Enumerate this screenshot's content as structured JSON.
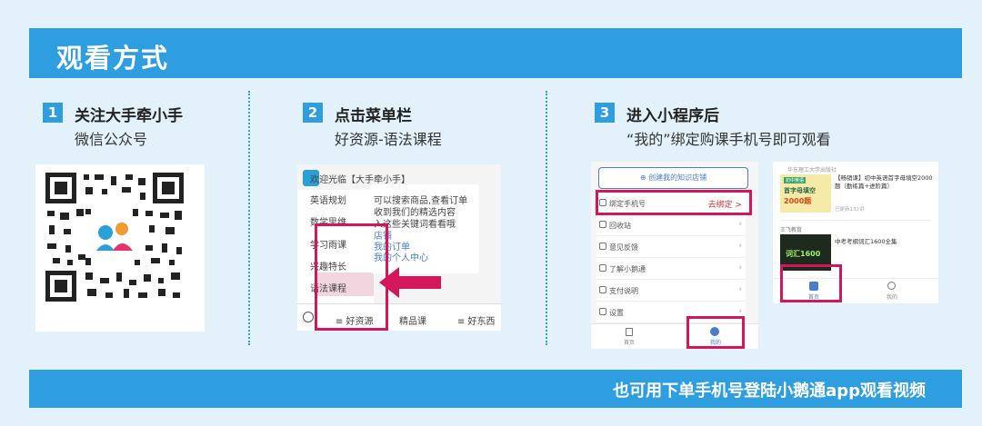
{
  "header": {
    "title": "观看方式"
  },
  "footer": {
    "text": "也可用下单手机号登陆小鹅通app观看视频"
  },
  "steps": [
    {
      "number": "1",
      "title": "关注大手牵小手",
      "subtitle": "微信公众号"
    },
    {
      "number": "2",
      "title": "点击菜单栏",
      "subtitle": "好资源-语法课程"
    },
    {
      "number": "3",
      "title": "进入小程序后",
      "subtitle": "“我的”绑定购课手机号即可观看"
    }
  ],
  "wechat": {
    "greeting": "欢迎光临【大手牵小手】",
    "menu_items": [
      "英语规划",
      "数学思维",
      "学习雨课",
      "兴趣特长",
      "语法课程"
    ],
    "chat_lines": [
      "可以搜索商品,查看订单",
      "收到我们的精选内容",
      "入这些关键词看看哦",
      "店铺",
      "我的订单",
      "我的个人中心"
    ],
    "bottom_tabs": [
      "≡ 好资源",
      "精品课",
      "≡ 好东西"
    ]
  },
  "miniapp": {
    "create_btn": "创建我的知识店铺",
    "bind_label": "绑定手机号",
    "bind_status": "去绑定 >",
    "rows": [
      "回收站",
      "意见反馈",
      "了解小鹅通",
      "支付说明",
      "设置"
    ],
    "tabs": [
      "首页",
      "我的"
    ]
  },
  "course": {
    "school": "华东理工大学出版社",
    "title1": "【畅销课】初中英语首字母填空2000题（勤练篇+进阶篇）",
    "badge_top": "初中英语",
    "badge_main": "首字母填空",
    "badge_num": "2000题",
    "meta1": "已更新132讲",
    "section": "王飞教育",
    "title2": "中考考纲词汇1600全集",
    "thumb_text": "词汇1600",
    "tabs": [
      "首页",
      "我的"
    ]
  }
}
